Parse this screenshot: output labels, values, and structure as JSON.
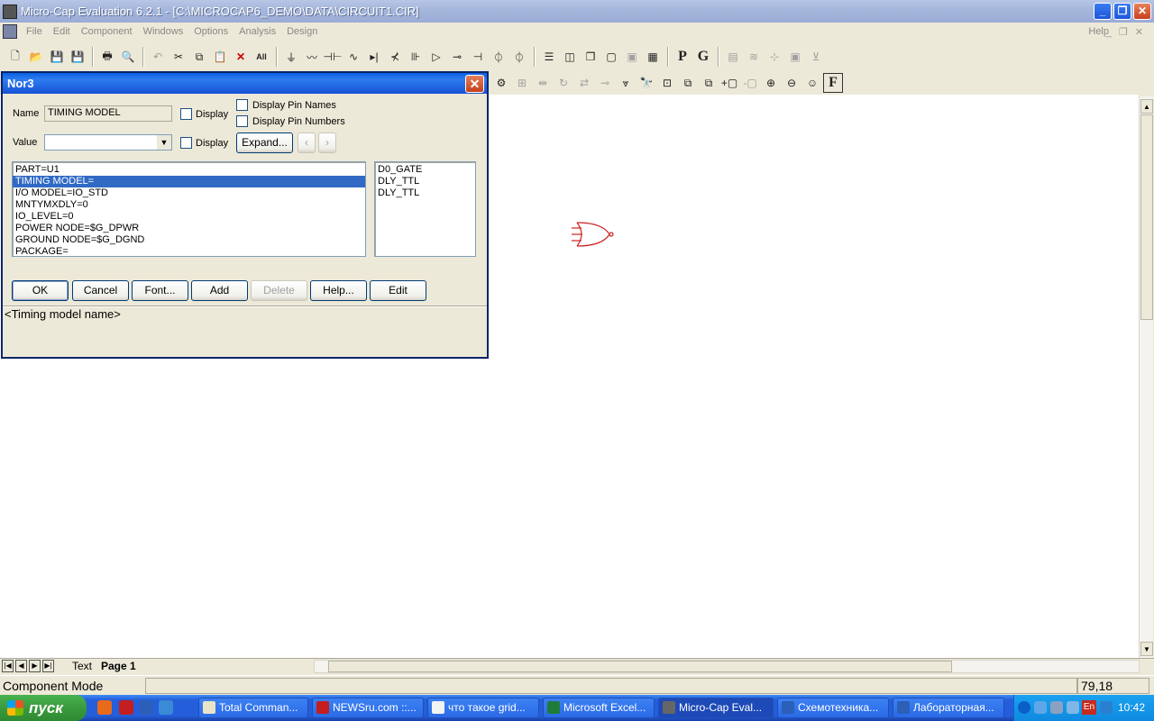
{
  "window": {
    "title": "Micro-Cap Evaluation 6.2.1 - [C:\\MICROCAP6_DEMO\\DATA\\CIRCUIT1.CIR]"
  },
  "menu": {
    "items": [
      "File",
      "Edit",
      "Component",
      "Windows",
      "Options",
      "Analysis",
      "Design"
    ],
    "help": "Help"
  },
  "toolbar1": {
    "p_label": "P",
    "g_label": "G"
  },
  "toolbar2": {
    "f_label": "F"
  },
  "dialog": {
    "title": "Nor3",
    "name_label": "Name",
    "name_value": "TIMING MODEL",
    "display_label": "Display",
    "display_pin_names": "Display Pin Names",
    "display_pin_numbers": "Display Pin Numbers",
    "value_label": "Value",
    "value_value": "",
    "expand_label": "Expand...",
    "attributes": [
      "PART=U1",
      "TIMING MODEL=",
      "I/O MODEL=IO_STD",
      "MNTYMXDLY=0",
      "IO_LEVEL=0",
      "POWER NODE=$G_DPWR",
      "GROUND NODE=$G_DGND",
      "PACKAGE="
    ],
    "selected_index": 1,
    "models": [
      "D0_GATE",
      "DLY_TTL",
      "DLY_TTL"
    ],
    "buttons": {
      "ok": "OK",
      "cancel": "Cancel",
      "font": "Font...",
      "add": "Add",
      "delete": "Delete",
      "help": "Help...",
      "edit": "Edit"
    },
    "hint": "<Timing model name>"
  },
  "tabs": {
    "text": "Text",
    "page1": "Page 1"
  },
  "status": {
    "mode": "Component Mode",
    "coords": "79,18"
  },
  "taskbar": {
    "start": "пуск",
    "tasks": [
      "Total Comman...",
      "NEWSru.com ::...",
      "что такое grid...",
      "Microsoft Excel...",
      "Micro-Cap Eval...",
      "Схемотехника...",
      "Лабораторная..."
    ],
    "active_index": 4,
    "lang": "En",
    "clock": "10:42"
  }
}
